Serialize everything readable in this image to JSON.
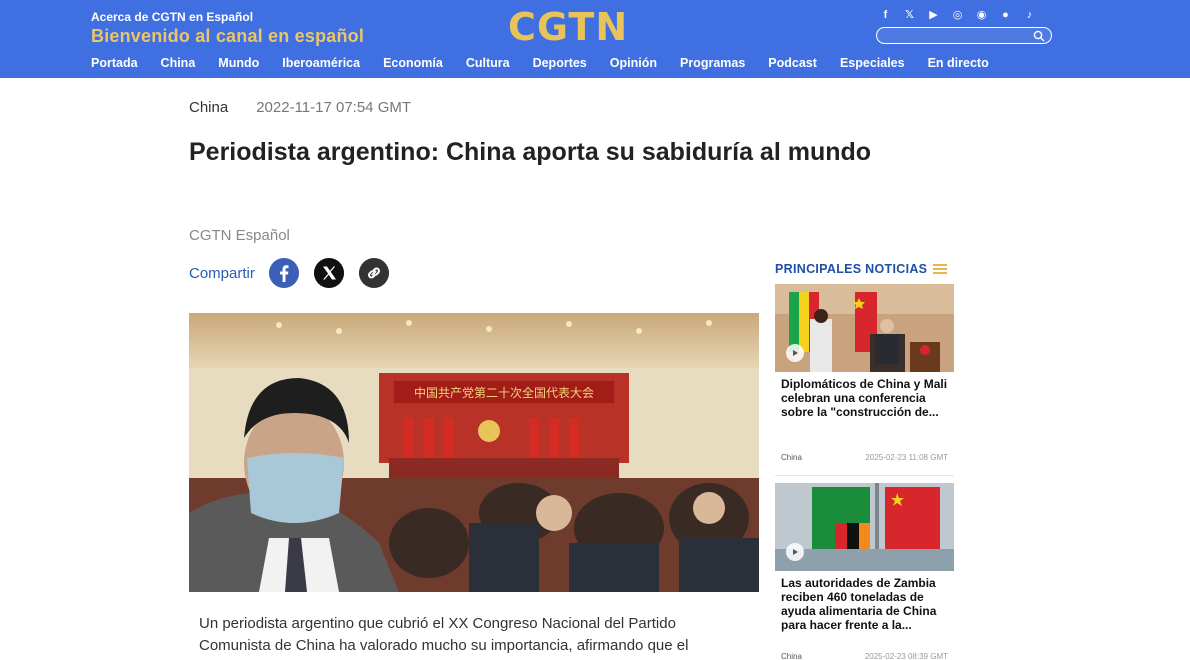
{
  "header": {
    "about": "Acerca de CGTN en Español",
    "welcome": "Bienvenido al canal en español",
    "logo": "CGTN",
    "colors": {
      "bar": "#3f6fe0",
      "gold": "#e8c35a"
    },
    "socials": [
      {
        "icon": "facebook-icon",
        "glyph": "f"
      },
      {
        "icon": "x-icon",
        "glyph": "𝕏"
      },
      {
        "icon": "youtube-icon",
        "glyph": "▶"
      },
      {
        "icon": "instagram-icon",
        "glyph": "◎"
      },
      {
        "icon": "weibo-icon",
        "glyph": "◉"
      },
      {
        "icon": "wechat-icon",
        "glyph": "●"
      },
      {
        "icon": "tiktok-icon",
        "glyph": "♪"
      }
    ],
    "search_placeholder": ""
  },
  "nav": [
    "Portada",
    "China",
    "Mundo",
    "Iberoamérica",
    "Economía",
    "Cultura",
    "Deportes",
    "Opinión",
    "Programas",
    "Podcast",
    "Especiales",
    "En directo"
  ],
  "article": {
    "category": "China",
    "datetime": "2022-11-17 07:54 GMT",
    "title": "Periodista argentino: China aporta su sabiduría al mundo",
    "author": "CGTN Español",
    "share_label": "Compartir",
    "banner_text": "中国共产党第二十次全国代表大会",
    "body": "Un periodista argentino que cubrió el XX Congreso Nacional del Partido Comunista de China ha valorado mucho su importancia, afirmando que el desarrollo de China está cambiando la forma del mundo"
  },
  "sidebar": {
    "title": "PRINCIPALES NOTICIAS",
    "items": [
      {
        "headline": "Diplomáticos de China y Mali celebran una conferencia sobre la \"construcción de...",
        "category": "China",
        "date": "2025-02-23 11:08 GMT"
      },
      {
        "headline": "Las autoridades de Zambia reciben 460 toneladas de ayuda alimentaria de China para hacer frente a la...",
        "category": "China",
        "date": "2025-02-23 08:39 GMT"
      }
    ]
  }
}
